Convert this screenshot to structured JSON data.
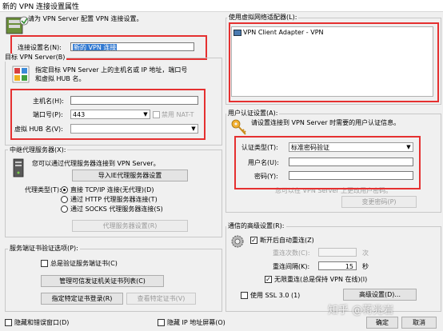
{
  "window": {
    "title": "新的 VPN 连接设置属性"
  },
  "intro": {
    "text": "请为 VPN Server 配置 VPN 连接设置。"
  },
  "connection": {
    "label": "连接设置名(N):",
    "value": "新的 VPN 连接"
  },
  "target": {
    "group_label": "目标 VPN Server(B)",
    "description_1": "指定目标 VPN Server 上的主机名或 IP 地址，端口号",
    "description_2": "和虚拟 HUB 名。",
    "host_label": "主机名(H):",
    "host_value": "",
    "port_label": "端口号(P):",
    "port_value": "443",
    "disable_nat_label": "禁用 NAT-T",
    "hub_label": "虚拟 HUB 名(V):",
    "hub_value": ""
  },
  "proxy": {
    "group_label": "中继代理服务器(X):",
    "description": "您可以通过代理服务器连接到 VPN Server。",
    "import_button": "导入IE代理服务器设置",
    "type_label": "代理类型(T):",
    "options": [
      "直接 TCP/IP 连接(无代理)(D)",
      "通过 HTTP 代理服务器连接(T)",
      "通过 SOCKS 代理服务器连接(S)"
    ],
    "settings_button": "代理服务器设置(R)"
  },
  "cert": {
    "group_label": "服务端证书验证选项(P):",
    "always_verify_label": "总是验证服务端证书(C)",
    "manage_ca_button": "管理可信发证机关证书列表(C)",
    "specify_button": "指定特定证书登录(R)",
    "view_button": "查看特定证书(V)"
  },
  "bottom": {
    "hide_status_label": "隐藏和错误窗口(D)",
    "hide_ip_label": "隐藏 IP 地址屏幕(O)"
  },
  "adapter": {
    "group_label": "使用虚拟网络适配器(L):",
    "items": [
      "VPN Client Adapter - VPN"
    ]
  },
  "auth": {
    "group_label": "用户认证设置(A):",
    "description": "请设置连接到 VPN Server 时需要的用户认证信息。",
    "type_label": "认证类型(T):",
    "type_value": "标准密码验证",
    "username_label": "用户名(U):",
    "username_value": "",
    "password_label": "密码(Y):",
    "password_value": "",
    "hint": "您可以在 VPN Server 上更改用户密码。",
    "change_password_button": "变更密码(P)"
  },
  "advanced": {
    "group_label": "通信的高级设置(R):",
    "auto_reconnect_label": "断开后自动重连(Z)",
    "retry_count_label": "重连次数(C):",
    "retry_count_value": "",
    "retry_count_unit": "次",
    "retry_interval_label": "重连间隔(K):",
    "retry_interval_value": "15",
    "retry_interval_unit": "秒",
    "infinite_label": "无限重连(总是保持 VPN 在线)(I)",
    "ssl_label": "使用 SSL 3.0 (1)",
    "advanced_button": "高级设置(D)..."
  },
  "footer": {
    "ok_button": "确定",
    "cancel_button": "取消",
    "watermark": "知乎 @蒋兆岩"
  }
}
